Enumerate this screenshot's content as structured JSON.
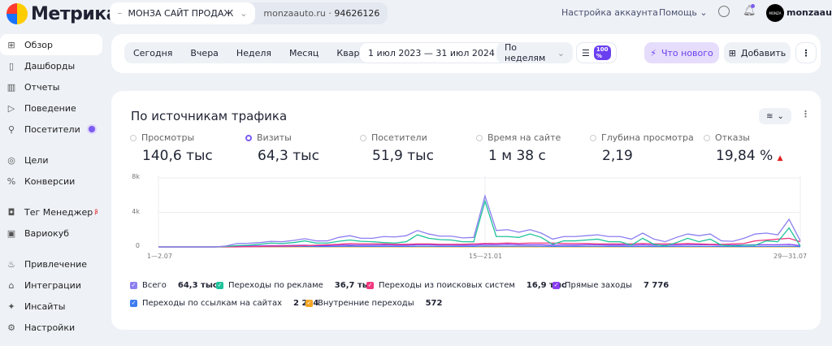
{
  "logo": "Метрика",
  "counter": {
    "name": "МОНЗА САЙТ ПРОДАЖ",
    "site": "monzaauto.ru",
    "sep": "·",
    "id": "94626126"
  },
  "top": {
    "account": "Настройка аккаунта",
    "help": "Помощь",
    "user": "monzaauto",
    "avatar": "MONZA"
  },
  "sidebar": [
    {
      "label": "Обзор",
      "icon": "grid-icon"
    },
    {
      "label": "Дашборды",
      "icon": "dashboard-icon"
    },
    {
      "label": "Отчеты",
      "icon": "chart-icon"
    },
    {
      "label": "Поведение",
      "icon": "play-icon"
    },
    {
      "label": "Посетители",
      "icon": "person-icon"
    },
    {
      "label": "Цели",
      "icon": "target-icon"
    },
    {
      "label": "Конверсии",
      "icon": "percent-icon"
    },
    {
      "label": "Тег Менеджер",
      "badge": "β",
      "icon": "tag-icon"
    },
    {
      "label": "Вариокуб",
      "icon": "cube-icon"
    },
    {
      "label": "Привлечение",
      "icon": "fire-icon"
    },
    {
      "label": "Интеграции",
      "icon": "puzzle-icon"
    },
    {
      "label": "Инсайты",
      "icon": "sparkle-icon"
    },
    {
      "label": "Настройки",
      "icon": "gear-icon"
    }
  ],
  "toolbar": {
    "periods": [
      "Сегодня",
      "Вчера",
      "Неделя",
      "Месяц",
      "Квартал"
    ],
    "range": "1 июл 2023 — 31 июл 2024",
    "grouping": "По неделям",
    "sampling": "100 %",
    "whats_new": "Что нового",
    "add": "Добавить"
  },
  "card": {
    "title": "По источникам трафика"
  },
  "metrics": [
    {
      "label": "Просмотры",
      "value": "140,6 тыс"
    },
    {
      "label": "Визиты",
      "value": "64,3 тыс",
      "selected": true
    },
    {
      "label": "Посетители",
      "value": "51,9 тыс"
    },
    {
      "label": "Время на сайте",
      "value": "1 м 38 с"
    },
    {
      "label": "Глубина просмотра",
      "value": "2,19"
    },
    {
      "label": "Отказы",
      "value": "19,84 %",
      "trend": "▲"
    }
  ],
  "chart_data": {
    "type": "line",
    "ylim": [
      0,
      8000
    ],
    "yticks": [
      "8k",
      "4k",
      "0"
    ],
    "xticks": [
      "1—2.07",
      "15—21.01",
      "29—31.07"
    ],
    "x_start": "1—2.07 2023",
    "x_unit": "week",
    "grid": true,
    "series": [
      {
        "name": "Всего",
        "total": "64,3 тыс",
        "color": "#8c7ff0",
        "values": [
          0,
          0,
          0,
          0,
          0,
          0,
          100,
          400,
          420,
          500,
          650,
          600,
          750,
          950,
          700,
          700,
          1100,
          1300,
          1000,
          1000,
          1200,
          1150,
          1300,
          1900,
          1500,
          1250,
          1250,
          1050,
          1100,
          5900,
          1900,
          2000,
          1700,
          2000,
          1600,
          900,
          1200,
          1200,
          1300,
          1400,
          1200,
          1200,
          900,
          1600,
          900,
          600,
          1100,
          1500,
          1300,
          1500,
          700,
          650,
          1000,
          1500,
          1600,
          1400,
          3200,
          700
        ]
      },
      {
        "name": "Переходы по рекламе",
        "total": "36,7 тыс",
        "color": "#1ec29b",
        "values": [
          0,
          0,
          0,
          0,
          0,
          0,
          50,
          150,
          200,
          300,
          450,
          400,
          500,
          700,
          450,
          450,
          650,
          800,
          650,
          600,
          500,
          450,
          600,
          1400,
          1000,
          850,
          800,
          600,
          600,
          5300,
          1200,
          1200,
          1100,
          1500,
          1100,
          300,
          700,
          700,
          800,
          900,
          600,
          600,
          200,
          1000,
          300,
          100,
          500,
          1000,
          600,
          900,
          200,
          100,
          200,
          200,
          700,
          600,
          2200,
          100
        ]
      },
      {
        "name": "Переходы из поисковых систем",
        "total": "16,9 тыс",
        "color": "#f0397f",
        "values": [
          0,
          0,
          0,
          0,
          0,
          0,
          0,
          0,
          20,
          50,
          80,
          100,
          120,
          150,
          200,
          250,
          300,
          400,
          350,
          350,
          350,
          300,
          300,
          350,
          350,
          300,
          300,
          300,
          350,
          400,
          400,
          450,
          400,
          450,
          450,
          450,
          400,
          400,
          400,
          350,
          350,
          350,
          350,
          400,
          350,
          350,
          350,
          400,
          350,
          300,
          300,
          350,
          400,
          700,
          800,
          900,
          1000,
          600
        ]
      },
      {
        "name": "Прямые заходы",
        "total": "7 776",
        "color": "#8a3ff0",
        "values": [
          0,
          0,
          0,
          0,
          0,
          0,
          50,
          80,
          100,
          120,
          150,
          150,
          180,
          200,
          150,
          150,
          200,
          220,
          200,
          200,
          220,
          200,
          200,
          250,
          250,
          220,
          220,
          200,
          200,
          300,
          250,
          300,
          250,
          250,
          250,
          200,
          220,
          220,
          250,
          250,
          220,
          220,
          200,
          250,
          200,
          200,
          220,
          250,
          250,
          250,
          200,
          200,
          220,
          250,
          250,
          250,
          300,
          150
        ]
      },
      {
        "name": "Переходы по ссылкам на сайтах",
        "total": "2 224",
        "color": "#3d7df0",
        "values": [
          0,
          0,
          0,
          0,
          0,
          0,
          20,
          30,
          40,
          40,
          50,
          50,
          60,
          60,
          50,
          50,
          60,
          80,
          60,
          60,
          60,
          60,
          60,
          70,
          70,
          60,
          60,
          60,
          60,
          100,
          80,
          80,
          80,
          80,
          70,
          60,
          60,
          60,
          70,
          70,
          60,
          60,
          50,
          60,
          50,
          50,
          60,
          60,
          60,
          60,
          50,
          50,
          50,
          60,
          60,
          60,
          80,
          40
        ]
      },
      {
        "name": "Внутренние переходы",
        "total": "572",
        "color": "#f5a623",
        "values": [
          0,
          0,
          0,
          0,
          0,
          0,
          5,
          10,
          10,
          10,
          10,
          10,
          10,
          15,
          10,
          10,
          10,
          15,
          10,
          10,
          10,
          10,
          10,
          15,
          15,
          10,
          10,
          10,
          10,
          20,
          15,
          15,
          15,
          15,
          10,
          10,
          10,
          10,
          10,
          15,
          10,
          10,
          10,
          10,
          10,
          10,
          10,
          10,
          10,
          10,
          10,
          10,
          10,
          10,
          10,
          10,
          15,
          10
        ]
      }
    ]
  }
}
